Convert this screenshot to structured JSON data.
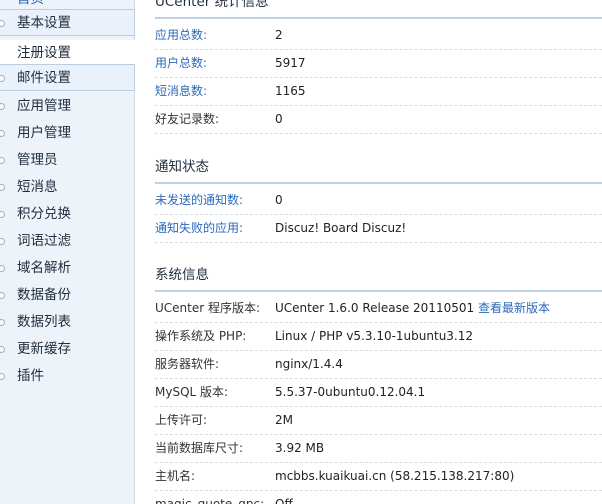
{
  "sidebar": {
    "items": [
      {
        "label": "首页"
      },
      {
        "label": "基本设置"
      },
      {
        "label": "注册设置"
      },
      {
        "label": "邮件设置"
      },
      {
        "label": "应用管理"
      },
      {
        "label": "用户管理"
      },
      {
        "label": "管理员"
      },
      {
        "label": "短消息"
      },
      {
        "label": "积分兑换"
      },
      {
        "label": "词语过滤"
      },
      {
        "label": "域名解析"
      },
      {
        "label": "数据备份"
      },
      {
        "label": "数据列表"
      },
      {
        "label": "更新缓存"
      },
      {
        "label": "插件"
      }
    ]
  },
  "stats": {
    "title": "UCenter 统计信息",
    "rows": [
      {
        "key": "应用总数:",
        "value": "2"
      },
      {
        "key": "用户总数:",
        "value": "5917"
      },
      {
        "key": "短消息数:",
        "value": "1165"
      },
      {
        "key": "好友记录数:",
        "value": "0"
      }
    ]
  },
  "notify": {
    "title": "通知状态",
    "rows": [
      {
        "key": "未发送的通知数:",
        "value": "0"
      },
      {
        "key": "通知失败的应用:",
        "value": "Discuz! Board  Discuz!"
      }
    ]
  },
  "system": {
    "title": "系统信息",
    "rows": [
      {
        "key": "UCenter 程序版本:",
        "value": "UCenter 1.6.0 Release 20110501",
        "link": "查看最新版本"
      },
      {
        "key": "操作系统及 PHP:",
        "value": "Linux / PHP v5.3.10-1ubuntu3.12"
      },
      {
        "key": "服务器软件:",
        "value": "nginx/1.4.4"
      },
      {
        "key": "MySQL 版本:",
        "value": "5.5.37-0ubuntu0.12.04.1"
      },
      {
        "key": "上传许可:",
        "value": "2M"
      },
      {
        "key": "当前数据库尺寸:",
        "value": "3.92 MB"
      },
      {
        "key": "主机名:",
        "value": "mcbbs.kuaikuai.cn (58.215.138.217:80)"
      },
      {
        "key": "magic_quote_gpc:",
        "value": "Off"
      }
    ]
  }
}
